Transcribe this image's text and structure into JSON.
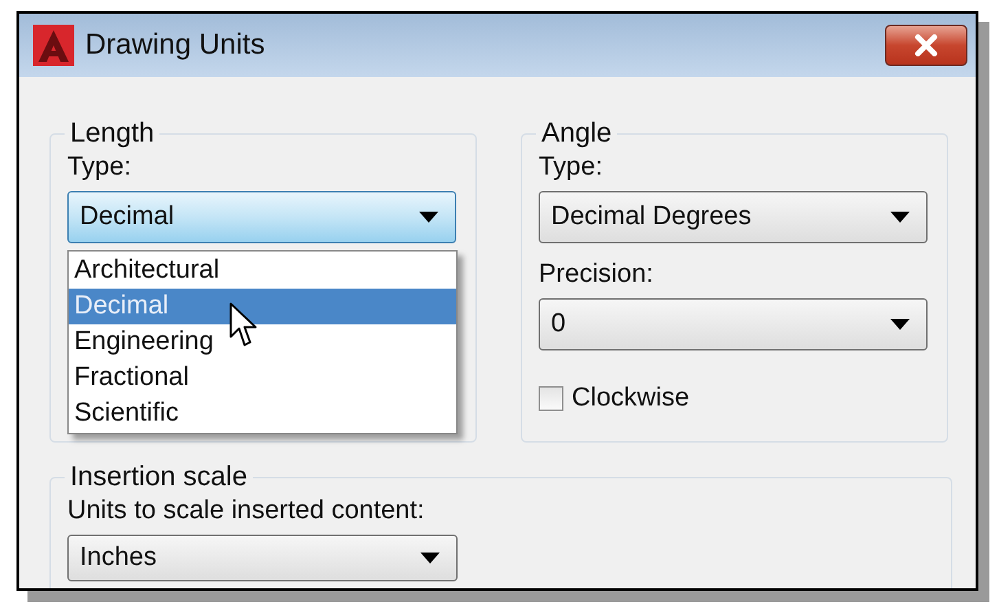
{
  "window": {
    "title": "Drawing Units"
  },
  "length": {
    "title": "Length",
    "type_label": "Type:",
    "type_value": "Decimal",
    "expanded": true,
    "options": [
      {
        "label": "Architectural",
        "selected": false
      },
      {
        "label": "Decimal",
        "selected": true
      },
      {
        "label": "Engineering",
        "selected": false
      },
      {
        "label": "Fractional",
        "selected": false
      },
      {
        "label": "Scientific",
        "selected": false
      }
    ]
  },
  "angle": {
    "title": "Angle",
    "type_label": "Type:",
    "type_value": "Decimal Degrees",
    "precision_label": "Precision:",
    "precision_value": "0",
    "clockwise": {
      "label": "Clockwise",
      "checked": false
    }
  },
  "insertion_scale": {
    "title": "Insertion scale",
    "units_label": "Units to scale inserted content:",
    "units_value": "Inches"
  }
}
